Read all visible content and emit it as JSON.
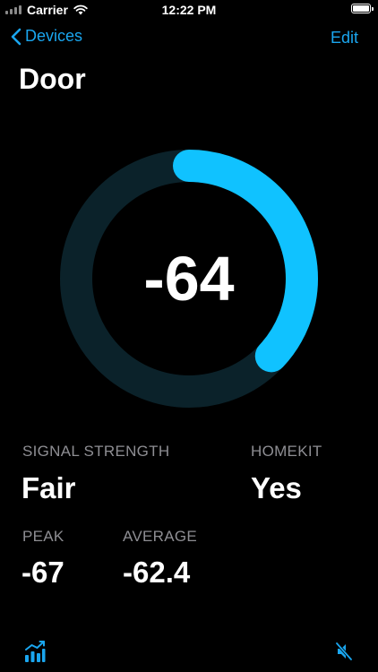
{
  "status_bar": {
    "carrier": "Carrier",
    "time": "12:22 PM"
  },
  "nav": {
    "back_label": "Devices",
    "edit_label": "Edit"
  },
  "page": {
    "title": "Door"
  },
  "gauge": {
    "value": "-64",
    "level_fraction": 0.37,
    "track_color": "#0b222a",
    "progress_color": "#10c2ff"
  },
  "stats": {
    "signal_strength": {
      "label": "SIGNAL STRENGTH",
      "value": "Fair"
    },
    "homekit": {
      "label": "HOMEKIT",
      "value": "Yes"
    },
    "peak": {
      "label": "PEAK",
      "value": "-67"
    },
    "average": {
      "label": "AVERAGE",
      "value": "-62.4"
    }
  },
  "colors": {
    "accent": "#1aa6ef",
    "label_gray": "#8e8e93",
    "background": "#000000"
  },
  "toolbar": {
    "left_icon": "chart-bars-icon",
    "right_icon": "speaker-muted-icon"
  }
}
